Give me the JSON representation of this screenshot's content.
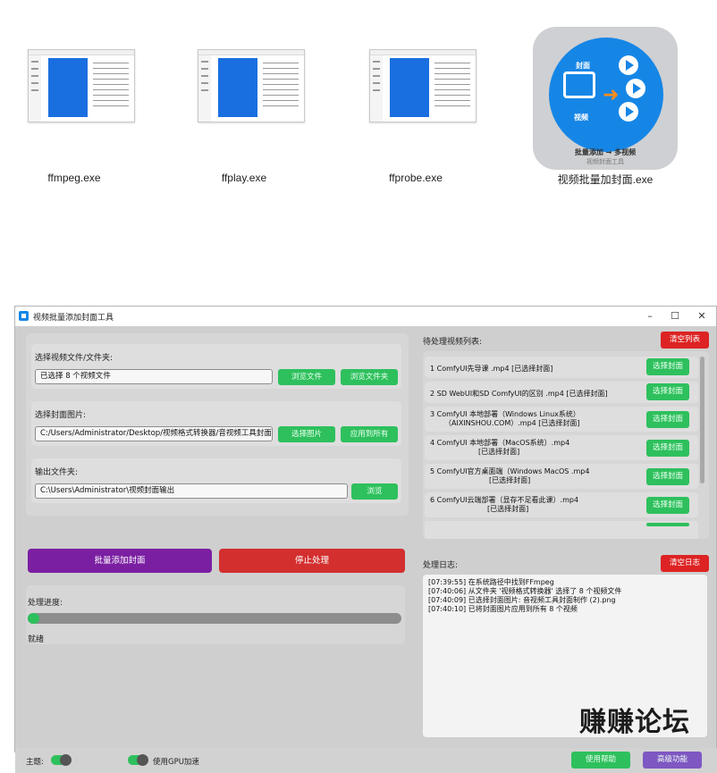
{
  "desktop": {
    "files": [
      {
        "name": "ffmpeg.exe",
        "icon": "window-thumbnail-icon"
      },
      {
        "name": "ffplay.exe",
        "icon": "window-thumbnail-icon"
      },
      {
        "name": "ffprobe.exe",
        "icon": "window-thumbnail-icon"
      },
      {
        "name": "视频批量加封面.exe",
        "icon": "app-icon"
      }
    ],
    "app_icon": {
      "cover_label": "封面",
      "video_label": "视频",
      "caption": "批量添加 → 多视频",
      "subcaption": "视频封面工具",
      "colors": {
        "disc": "#1686e6",
        "arrow": "#ff8c1a"
      }
    }
  },
  "window": {
    "title": "视频批量添加封面工具",
    "controls": {
      "minimize": "–",
      "maximize": "☐",
      "close": "✕"
    }
  },
  "inputs": {
    "video": {
      "label": "选择视频文件/文件夹:",
      "value": "已选择 8 个视频文件",
      "browse_file": "浏览文件",
      "browse_folder": "浏览文件夹"
    },
    "cover": {
      "label": "选择封面图片:",
      "value": "C:/Users/Administrator/Desktop/视频格式转换器/音视频工具封面制",
      "select_image": "选择图片",
      "apply_all": "应用到所有"
    },
    "output": {
      "label": "输出文件夹:",
      "value": "C:\\Users\\Administrator\\视频封面输出",
      "browse": "浏览"
    }
  },
  "actions": {
    "start": "批量添加封面",
    "stop": "停止处理",
    "colors": {
      "start": "#7b1fa2",
      "stop": "#d32f2f"
    }
  },
  "progress": {
    "label": "处理进度:",
    "value": 0.02,
    "status": "就绪"
  },
  "queue": {
    "title": "待处理视频列表:",
    "clear": "清空列表",
    "items": [
      {
        "line1": "1 ComfyUI先导课 .mp4 [已选择封面]",
        "line2": "",
        "button": "选择封面"
      },
      {
        "line1": "2 SD WebUI和SD ComfyUI的区别 .mp4 [已选择封面]",
        "line2": "",
        "button": "选择封面"
      },
      {
        "line1": "3 ComfyUI 本地部署（Windows Linux系统）",
        "line2": "（AIXINSHOU.COM）.mp4 [已选择封面]",
        "button": "选择封面"
      },
      {
        "line1": "4 ComfyUI 本地部署（MacOS系统）.mp4",
        "line2": "[已选择封面]",
        "button": "选择封面"
      },
      {
        "line1": "5 ComfyUI官方桌面端（Windows MacOS .mp4",
        "line2": "[已选择封面]",
        "button": "选择封面"
      },
      {
        "line1": "6 ComfyUI云端部署（显存不足看此课）.mp4",
        "line2": "[已选择封面]",
        "button": "选择封面"
      }
    ]
  },
  "log": {
    "title": "处理日志:",
    "clear": "清空日志",
    "lines": [
      "[07:39:55] 在系统路径中找到FFmpeg",
      "[07:40:06] 从文件夹 '视频格式转换器' 选择了 8 个视频文件",
      "[07:40:09] 已选择封面图片: 音视频工具封面制作 (2).png",
      "[07:40:10] 已将封面图片应用到所有 8 个视频"
    ]
  },
  "footer": {
    "theme_label": "主题:",
    "gpu_label": "使用GPU加速",
    "theme_on": true,
    "gpu_on": true,
    "help": "使用帮助",
    "advanced": "高级功能",
    "colors": {
      "help": "#2ec05d",
      "advanced": "#7e57c2"
    }
  },
  "watermark": "赚赚论坛"
}
